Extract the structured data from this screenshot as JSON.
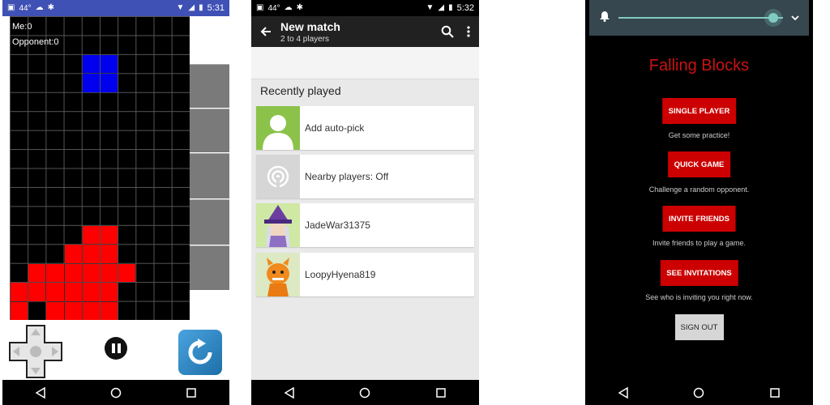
{
  "phone1": {
    "status": {
      "temp": "44°",
      "time": "5:31"
    },
    "game": {
      "me_label": "Me:0",
      "opponent_label": "Opponent:0"
    },
    "colors": {
      "active_piece": "#0000ee",
      "stack": "#ff0000",
      "board": "#000000"
    },
    "icons": {
      "dpad": "dpad-icon",
      "pause": "pause-icon",
      "rotate": "rotate-icon"
    }
  },
  "phone2": {
    "status": {
      "temp": "44°",
      "time": "5:32"
    },
    "appbar": {
      "title": "New match",
      "subtitle": "2 to 4 players"
    },
    "section_title": "Recently played",
    "rows": [
      {
        "label": "Add auto-pick",
        "icon": "auto-pick-person-icon"
      },
      {
        "label": "Nearby players: Off",
        "icon": "nearby-icon"
      },
      {
        "label": "JadeWar31375",
        "icon": "wizard-avatar"
      },
      {
        "label": "LoopyHyena819",
        "icon": "hyena-avatar"
      }
    ]
  },
  "phone3": {
    "title": "Falling Blocks",
    "title_color": "#cc1111",
    "buttons": [
      {
        "label": "SINGLE PLAYER",
        "desc": "Get some practice!"
      },
      {
        "label": "QUICK GAME",
        "desc": "Challenge a random opponent."
      },
      {
        "label": "INVITE FRIENDS",
        "desc": "Invite friends to play a game."
      },
      {
        "label": "SEE INVITATIONS",
        "desc": "See who is inviting you right now."
      }
    ],
    "signout_label": "SIGN OUT",
    "button_color": "#cc0000"
  }
}
